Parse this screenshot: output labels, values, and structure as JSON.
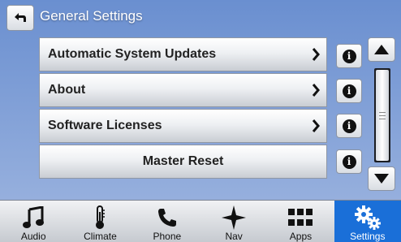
{
  "header": {
    "title": "General Settings"
  },
  "menu": {
    "items": [
      {
        "label": "Automatic System Updates",
        "has_chevron": true
      },
      {
        "label": "About",
        "has_chevron": true
      },
      {
        "label": "Software Licenses",
        "has_chevron": true
      },
      {
        "label": "Master Reset",
        "has_chevron": false
      }
    ]
  },
  "info_icons": [
    "info-icon",
    "info-icon",
    "info-icon",
    "info-icon"
  ],
  "nav": {
    "items": [
      {
        "label": "Audio",
        "icon": "music-note-icon"
      },
      {
        "label": "Climate",
        "icon": "thermometer-icon"
      },
      {
        "label": "Phone",
        "icon": "phone-icon"
      },
      {
        "label": "Nav",
        "icon": "compass-star-icon"
      },
      {
        "label": "Apps",
        "icon": "apps-grid-icon"
      },
      {
        "label": "Settings",
        "icon": "gears-icon",
        "active": true
      }
    ]
  },
  "colors": {
    "background_top": "#6a8fd0",
    "background_bottom": "#9fb6e0",
    "active_tab": "#1a6fd8"
  }
}
